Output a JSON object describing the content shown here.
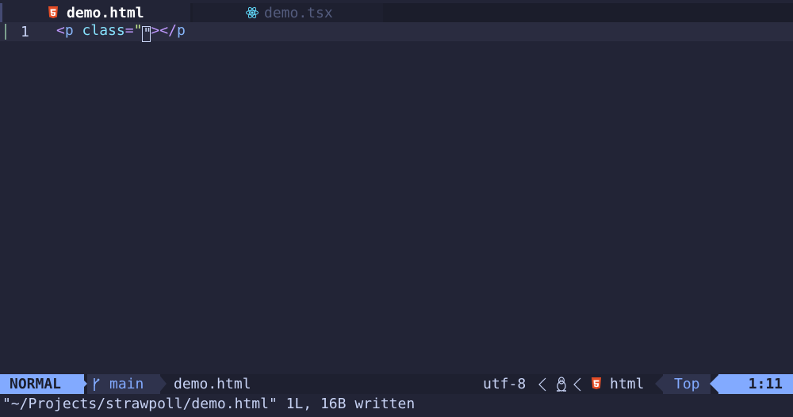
{
  "tabs": [
    {
      "label": "demo.html",
      "icon": "html5-icon",
      "active": true
    },
    {
      "label": "demo.tsx",
      "icon": "react-icon",
      "active": false
    }
  ],
  "editor": {
    "line_number": "1",
    "code": {
      "open_bracket": "<",
      "tag": "p",
      "attr": " class",
      "equals": "=",
      "quote_open": "\"",
      "cursor_char": "\"",
      "close_bracket": ">",
      "end_tag_open": "</",
      "end_tag": "p"
    }
  },
  "statusline": {
    "mode": "NORMAL",
    "branch": "main",
    "filename": "demo.html",
    "encoding": "utf-8",
    "filetype": "html",
    "position": "Top",
    "location": "1:11"
  },
  "cmdline": "\"~/Projects/strawpoll/demo.html\" 1L, 16B written",
  "colors": {
    "background": "#222436",
    "accent": "#82aaff",
    "html_icon": "#e44d26",
    "react_icon": "#61dafb"
  }
}
